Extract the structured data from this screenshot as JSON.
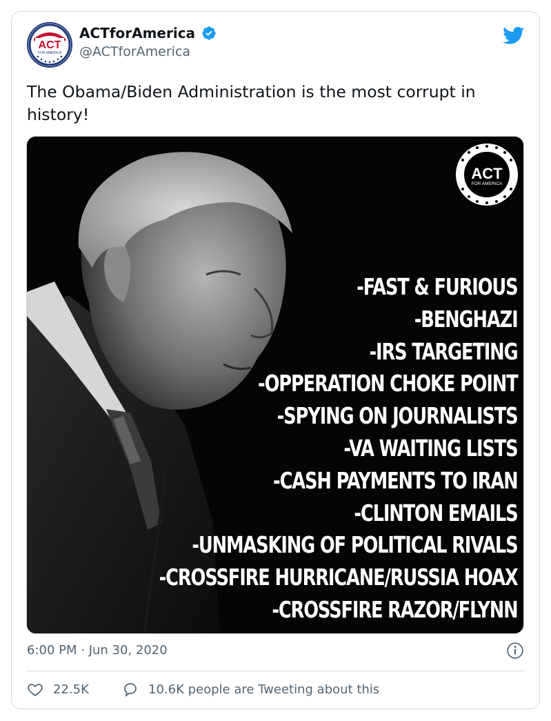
{
  "tweet": {
    "display_name": "ACTforAmerica",
    "handle": "@ACTforAmerica",
    "verified_icon": "verified-badge-icon",
    "brand_icon": "twitter-bird-icon",
    "text": "The Obama/Biden Administration is the most corrupt in history!",
    "avatar": {
      "logo_text": "ACT",
      "logo_sub": "FOR AMERICA"
    },
    "media": {
      "badge_text": "ACT",
      "badge_sub": "FOR AMERICA",
      "list": [
        "-FAST & FURIOUS",
        "-BENGHAZI",
        "-IRS TARGETING",
        "-OPPERATION CHOKE POINT",
        "-SPYING ON JOURNALISTS",
        "-VA WAITING LISTS",
        "-CASH PAYMENTS TO IRAN",
        "-CLINTON EMAILS",
        "-UNMASKING OF POLITICAL RIVALS",
        "-CROSSFIRE HURRICANE/RUSSIA HOAX",
        "-CROSSFIRE RAZOR/FLYNN"
      ]
    },
    "timestamp": "6:00 PM · Jun 30, 2020",
    "likes": "22.5K",
    "tweeting_text": "10.6K people are Tweeting about this"
  },
  "colors": {
    "twitter_blue": "#1d9bf0",
    "muted_text": "#536471",
    "border": "#cfd9de"
  }
}
